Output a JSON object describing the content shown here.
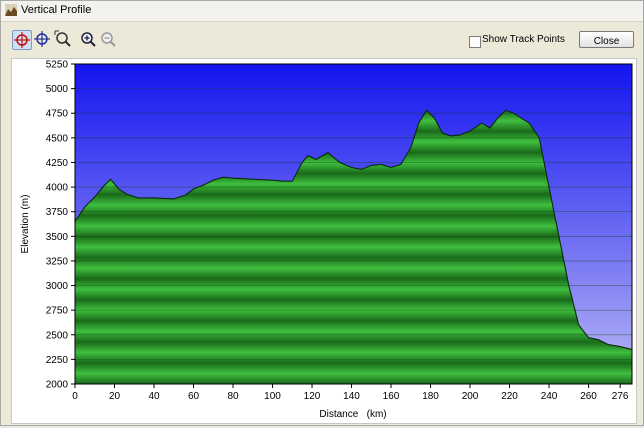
{
  "window": {
    "title": "Vertical Profile"
  },
  "toolbar": {
    "tools": [
      {
        "icon": "crosshair-select-icon",
        "active": true
      },
      {
        "icon": "crosshair-icon",
        "active": false
      },
      {
        "icon": "zoom-area-icon",
        "active": false
      },
      {
        "icon": "zoom-in-icon",
        "active": false
      },
      {
        "icon": "zoom-out-icon",
        "active": false
      }
    ],
    "show_track_points_label": "Show Track Points",
    "show_track_points_checked": false,
    "close_label": "Close"
  },
  "chart_data": {
    "type": "area",
    "xlabel": "Distance   (km)",
    "ylabel": "Elevation (m)",
    "xlim": [
      0,
      282
    ],
    "ylim": [
      2000,
      5250
    ],
    "xticks": [
      0,
      20,
      40,
      60,
      80,
      100,
      120,
      140,
      160,
      180,
      200,
      220,
      240,
      260,
      276
    ],
    "yticks": [
      2000,
      2250,
      2500,
      2750,
      3000,
      3250,
      3500,
      3750,
      4000,
      4250,
      4500,
      4750,
      5000,
      5250
    ],
    "grid": true,
    "x": [
      0,
      5,
      10,
      15,
      18,
      22,
      26,
      32,
      40,
      50,
      56,
      60,
      65,
      70,
      75,
      80,
      90,
      100,
      105,
      110,
      115,
      118,
      122,
      128,
      134,
      140,
      145,
      150,
      155,
      160,
      165,
      170,
      174,
      178,
      182,
      186,
      190,
      195,
      200,
      206,
      210,
      214,
      218,
      222,
      226,
      230,
      235,
      240,
      245,
      250,
      255,
      260,
      265,
      270,
      276,
      282
    ],
    "y": [
      3650,
      3800,
      3900,
      4020,
      4080,
      3980,
      3930,
      3890,
      3890,
      3880,
      3920,
      3980,
      4020,
      4070,
      4100,
      4090,
      4080,
      4070,
      4060,
      4060,
      4250,
      4320,
      4280,
      4350,
      4250,
      4200,
      4180,
      4220,
      4230,
      4200,
      4230,
      4400,
      4650,
      4780,
      4700,
      4550,
      4520,
      4530,
      4570,
      4650,
      4600,
      4700,
      4780,
      4750,
      4700,
      4650,
      4500,
      4000,
      3500,
      3000,
      2600,
      2470,
      2450,
      2400,
      2380,
      2350
    ],
    "colors": {
      "sky_top": "#1414f0",
      "sky_bottom": "#b9b9f5",
      "fill_light": "#3fbf3f",
      "fill_dark": "#1a6a1a",
      "outline": "#0a2a0a"
    }
  }
}
